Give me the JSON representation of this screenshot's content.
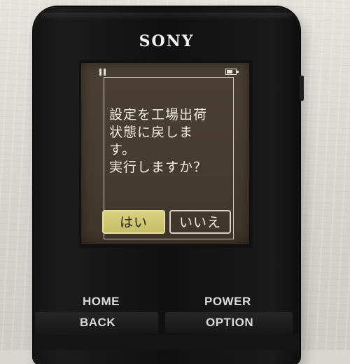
{
  "device": {
    "brand": "SONY"
  },
  "status_bar": {
    "play_state_icon": "pause-icon",
    "battery_icon": "battery-icon",
    "battery_level": 0.7
  },
  "dialog": {
    "message": "設定を工場出荷\n状態に戻しま\nす。\n実行しますか？",
    "confirm_label": "はい",
    "cancel_label": "いいえ",
    "selected": "confirm"
  },
  "hardware_keys": {
    "home": "HOME",
    "power": "POWER",
    "back": "BACK",
    "option": "OPTION"
  },
  "colors": {
    "screen_bg": "#463b2f",
    "selected_button": "#d2c977",
    "text": "#f0ede4"
  }
}
